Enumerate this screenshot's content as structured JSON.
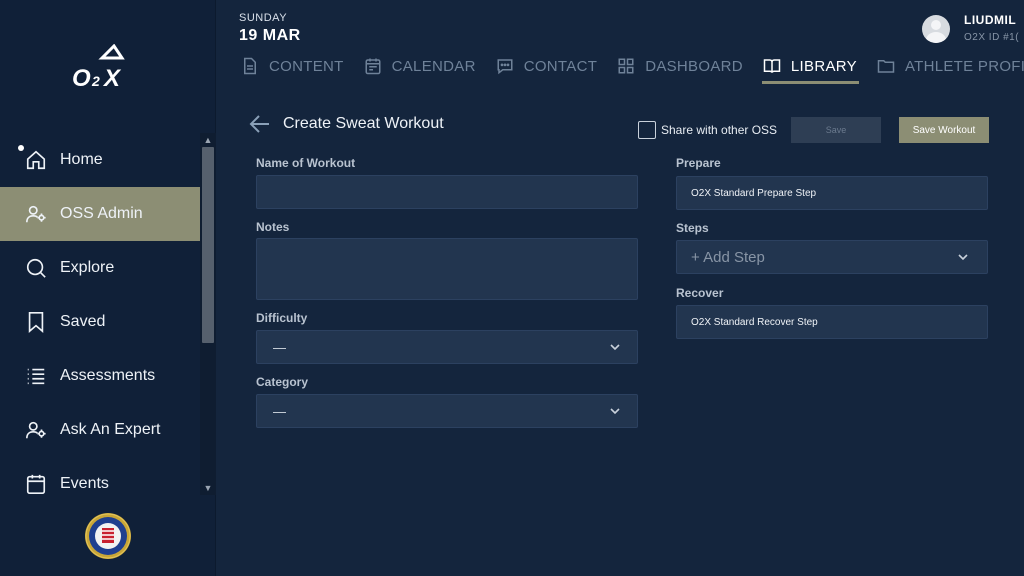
{
  "sidebar": {
    "items": [
      {
        "label": "Home",
        "icon": "home-icon"
      },
      {
        "label": "OSS Admin",
        "icon": "user-gear-icon",
        "active": true
      },
      {
        "label": "Explore",
        "icon": "search-icon"
      },
      {
        "label": "Saved",
        "icon": "bookmark-icon"
      },
      {
        "label": "Assessments",
        "icon": "list-icon"
      },
      {
        "label": "Ask An Expert",
        "icon": "user-gear-icon"
      },
      {
        "label": "Events",
        "icon": "calendar-icon"
      }
    ]
  },
  "header": {
    "day": "SUNDAY",
    "date": "19 MAR",
    "user_name": "LIUDMIL",
    "user_id": "O2X ID #1("
  },
  "tabs": [
    {
      "label": "CONTENT",
      "icon": "document-icon"
    },
    {
      "label": "CALENDAR",
      "icon": "calendar-icon"
    },
    {
      "label": "CONTACT",
      "icon": "chat-icon"
    },
    {
      "label": "DASHBOARD",
      "icon": "grid-icon"
    },
    {
      "label": "LIBRARY",
      "icon": "book-icon",
      "active": true
    },
    {
      "label": "ATHLETE PROFILE",
      "icon": "folder-icon"
    }
  ],
  "form": {
    "title": "Create Sweat Workout",
    "share_label": "Share with other OSS",
    "save_label": "Save",
    "save_workout_label": "Save Workout",
    "name_label": "Name of Workout",
    "name_value": "",
    "notes_label": "Notes",
    "notes_value": "",
    "difficulty_label": "Difficulty",
    "difficulty_value": "—",
    "category_label": "Category",
    "category_value": "—",
    "prepare_label": "Prepare",
    "prepare_value": "O2X Standard Prepare Step",
    "steps_label": "Steps",
    "steps_placeholder": "+ Add Step",
    "recover_label": "Recover",
    "recover_value": "O2X Standard Recover Step"
  },
  "colors": {
    "background": "#14253d",
    "sidebar": "#102038",
    "accent": "#8c8e74",
    "field": "#22354f"
  }
}
